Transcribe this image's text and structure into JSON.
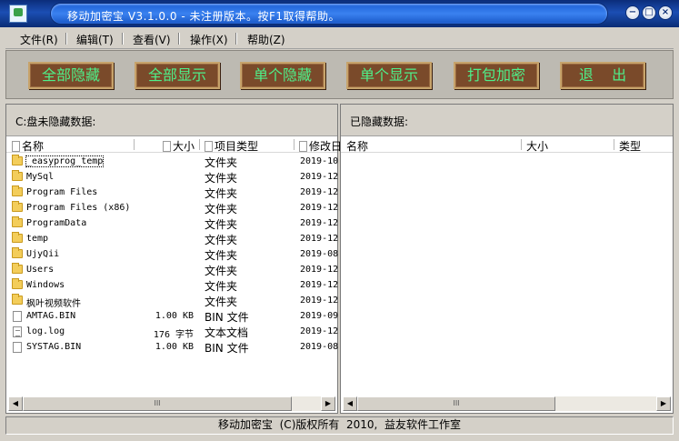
{
  "window": {
    "title": "移动加密宝 V3.1.0.0 - 未注册版本。按F1取得帮助。"
  },
  "titlebar_buttons": {
    "minimize": "−",
    "restore": "□",
    "close": "×"
  },
  "menu": [
    "文件(R)",
    "编辑(T)",
    "查看(V)",
    "操作(X)",
    "帮助(Z)"
  ],
  "toolbar": {
    "hide_all": "全部隐藏",
    "show_all": "全部显示",
    "hide_one": "单个隐藏",
    "show_one": "单个显示",
    "pack_encrypt": "打包加密",
    "exit": "退    出"
  },
  "left_panel": {
    "title": "C:盘未隐藏数据:",
    "columns": [
      "名称",
      "大小",
      "项目类型",
      "修改日"
    ],
    "rows": [
      {
        "icon": "folder-icon",
        "name": "_easyprog_temp",
        "size": "",
        "type": "文件夹",
        "date": "2019-10"
      },
      {
        "icon": "folder-icon",
        "name": "MySql",
        "size": "",
        "type": "文件夹",
        "date": "2019-12"
      },
      {
        "icon": "folder-icon",
        "name": "Program Files",
        "size": "",
        "type": "文件夹",
        "date": "2019-12"
      },
      {
        "icon": "folder-icon",
        "name": "Program Files (x86)",
        "size": "",
        "type": "文件夹",
        "date": "2019-12"
      },
      {
        "icon": "folder-icon",
        "name": "ProgramData",
        "size": "",
        "type": "文件夹",
        "date": "2019-12"
      },
      {
        "icon": "folder-icon",
        "name": "temp",
        "size": "",
        "type": "文件夹",
        "date": "2019-12"
      },
      {
        "icon": "folder-icon",
        "name": "UjyQii",
        "size": "",
        "type": "文件夹",
        "date": "2019-08"
      },
      {
        "icon": "folder-icon",
        "name": "Users",
        "size": "",
        "type": "文件夹",
        "date": "2019-12"
      },
      {
        "icon": "folder-icon",
        "name": "Windows",
        "size": "",
        "type": "文件夹",
        "date": "2019-12"
      },
      {
        "icon": "folder-icon",
        "name": "枫叶视频软件",
        "size": "",
        "type": "文件夹",
        "date": "2019-12"
      },
      {
        "icon": "file-icon",
        "name": "AMTAG.BIN",
        "size": "1.00 KB",
        "type": "BIN 文件",
        "date": "2019-09"
      },
      {
        "icon": "text-file-icon",
        "name": "log.log",
        "size": "176 字节",
        "type": "文本文档",
        "date": "2019-12"
      },
      {
        "icon": "file-icon",
        "name": "SYSTAG.BIN",
        "size": "1.00 KB",
        "type": "BIN 文件",
        "date": "2019-08"
      }
    ]
  },
  "right_panel": {
    "title": "已隐藏数据:",
    "columns": [
      "名称",
      "大小",
      "类型"
    ],
    "rows": []
  },
  "scrollbar": {
    "thumb_grip": "III",
    "left_arrow": "◀",
    "right_arrow": "▶"
  },
  "status": {
    "text": "移动加密宝  (C)版权所有  2010,  益友软件工作室"
  }
}
